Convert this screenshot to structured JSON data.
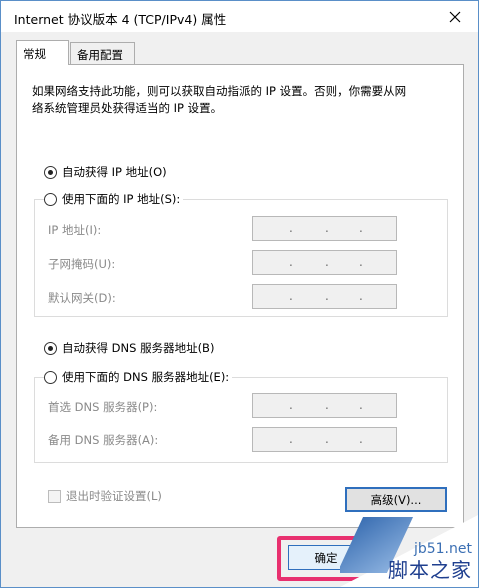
{
  "window": {
    "title": "Internet 协议版本 4 (TCP/IPv4) 属性"
  },
  "tabs": [
    {
      "label": "常规"
    },
    {
      "label": "备用配置"
    }
  ],
  "description": {
    "line1": "如果网络支持此功能，则可以获取自动指派的 IP 设置。否则，你需要从网",
    "line2": "络系统管理员处获得适当的 IP 设置。"
  },
  "ip_options": {
    "auto_label": "自动获得 IP 地址(O)",
    "manual_label": "使用下面的 IP 地址(S):"
  },
  "ip_fields": [
    {
      "label": "IP 地址(I):",
      "value": ". . ."
    },
    {
      "label": "子网掩码(U):",
      "value": ". . ."
    },
    {
      "label": "默认网关(D):",
      "value": ". . ."
    }
  ],
  "dns_options": {
    "auto_label": "自动获得 DNS 服务器地址(B)",
    "manual_label": "使用下面的 DNS 服务器地址(E):"
  },
  "dns_fields": [
    {
      "label": "首选 DNS 服务器(P):",
      "value": ". . ."
    },
    {
      "label": "备用 DNS 服务器(A):",
      "value": ". . ."
    }
  ],
  "validate_checkbox": {
    "label": "退出时验证设置(L)"
  },
  "buttons": {
    "advanced": "高级(V)...",
    "ok": "确定"
  },
  "watermark": {
    "site": "jb51.net",
    "name": "脚本之家"
  },
  "colors": {
    "desktop": "#1ba1e2",
    "highlight": "#e8306f",
    "focus": "#2f6fbd"
  }
}
